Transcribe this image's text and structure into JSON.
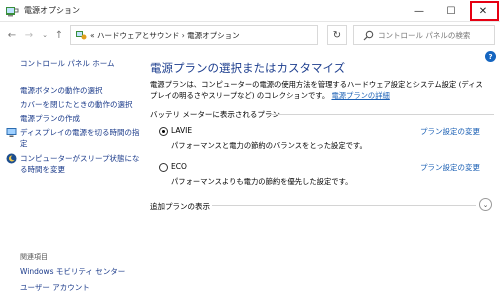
{
  "window": {
    "title": "電源オプション",
    "minimize_glyph": "—",
    "maximize_glyph": "☐",
    "close_glyph": "✕",
    "close_highlight_color": "#e60012"
  },
  "nav": {
    "back_glyph": "←",
    "forward_glyph": "→",
    "recent_glyph": "⌄",
    "up_glyph": "↑",
    "address_path": "« ハードウェアとサウンド › 電源オプション",
    "address_dropdown_glyph": "⌄",
    "refresh_glyph": "↻",
    "search_placeholder": "コントロール パネルの検索"
  },
  "help_glyph": "?",
  "sidebar": {
    "home": "コントロール パネル ホーム",
    "links": [
      "電源ボタンの動作の選択",
      "カバーを閉じたときの動作の選択",
      "電源プランの作成",
      "ディスプレイの電源を切る時間の指定",
      "コンピューターがスリープ状態になる時間を変更"
    ],
    "related_title": "関連項目",
    "related_links": [
      "Windows モビリティ センター",
      "ユーザー アカウント"
    ]
  },
  "main": {
    "heading": "電源プランの選択またはカスタマイズ",
    "description": "電源プランは、コンピューターの電源の使用方法を管理するハードウェア設定とシステム設定 (ディスプレイの明るさやスリープなど) のコレクションです。",
    "description_link": "電源プランの詳細",
    "section_label": "バッテリ メーターに表示されるプラン",
    "plans": [
      {
        "name": "LAVIE",
        "description": "パフォーマンスと電力の節約のバランスをとった設定です。",
        "change_link": "プラン設定の変更",
        "selected": true
      },
      {
        "name": "ECO",
        "description": "パフォーマンスよりも電力の節約を優先した設定です。",
        "change_link": "プラン設定の変更",
        "selected": false
      }
    ],
    "extra_plans_label": "追加プランの表示",
    "expand_glyph": "⌄"
  },
  "colors": {
    "heading": "#1e3f8f",
    "link": "#1a5fb4"
  },
  "icons": {
    "app": "power-options-icon",
    "address": "control-panel-icon",
    "search": "search-icon",
    "display_power": "monitor-icon",
    "sleep": "moon-globe-icon"
  }
}
